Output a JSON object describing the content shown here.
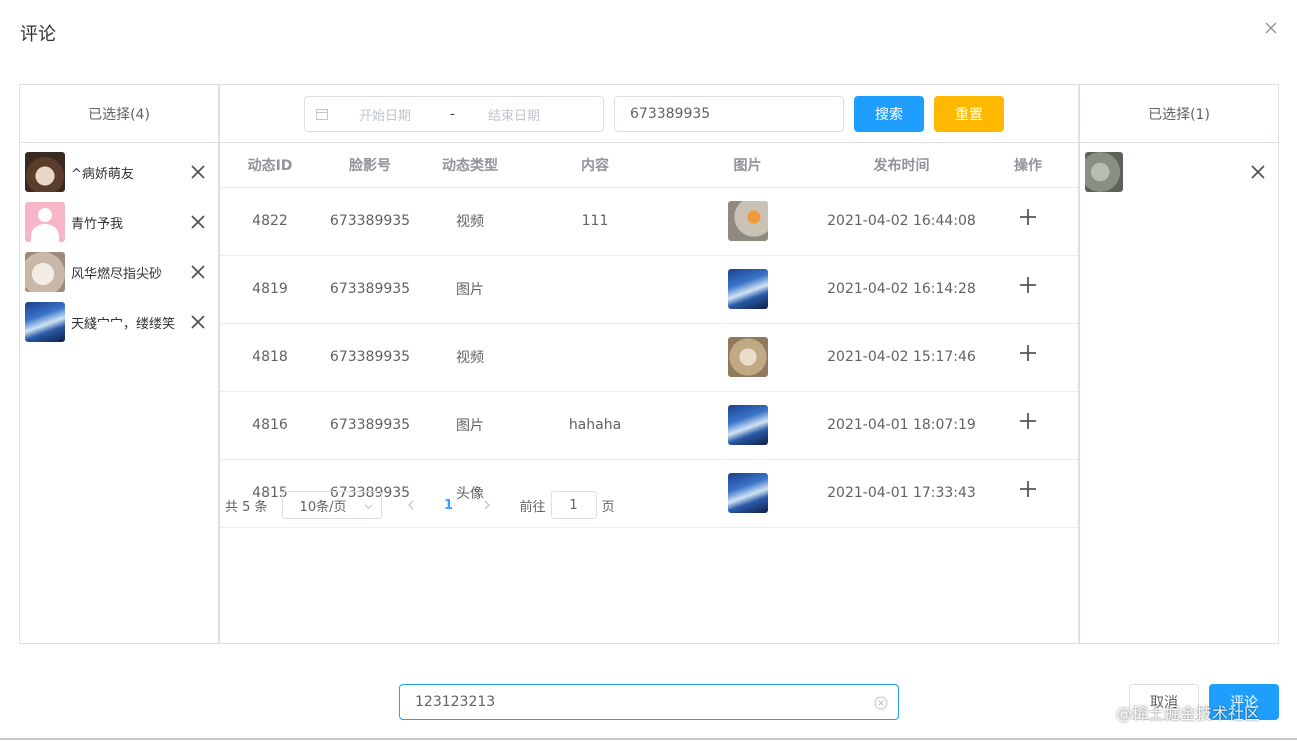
{
  "dialog": {
    "title": "评论"
  },
  "left_panel": {
    "header": "已选择(4)",
    "items": [
      {
        "name": "^病娇萌友",
        "avatar": "cat-avatar"
      },
      {
        "name": "青竹予我",
        "avatar": "pink-silhouette-avatar"
      },
      {
        "name": "风华燃尽指尖砂",
        "avatar": "hamster-avatar"
      },
      {
        "name": "天綫宀宀，缕缕笑",
        "avatar": "sea-avatar"
      }
    ]
  },
  "search": {
    "start_placeholder": "开始日期",
    "separator": "-",
    "end_placeholder": "结束日期",
    "keyword_value": "673389935",
    "search_label": "搜索",
    "reset_label": "重置"
  },
  "table": {
    "columns": [
      "动态ID",
      "脸影号",
      "动态类型",
      "内容",
      "图片",
      "发布时间",
      "操作"
    ],
    "rows": [
      {
        "id": "4822",
        "account": "673389935",
        "type": "视频",
        "content": "111",
        "image": "rock-orange-thumb",
        "time": "2021-04-02 16:44:08"
      },
      {
        "id": "4819",
        "account": "673389935",
        "type": "图片",
        "content": "",
        "image": "sea-thumb",
        "time": "2021-04-02 16:14:28"
      },
      {
        "id": "4818",
        "account": "673389935",
        "type": "视频",
        "content": "",
        "image": "food-thumb",
        "time": "2021-04-02 15:17:46"
      },
      {
        "id": "4816",
        "account": "673389935",
        "type": "图片",
        "content": "hahaha",
        "image": "sea-thumb",
        "time": "2021-04-01 18:07:19"
      },
      {
        "id": "4815",
        "account": "673389935",
        "type": "头像",
        "content": "",
        "image": "sea-thumb",
        "time": "2021-04-01 17:33:43"
      }
    ]
  },
  "pagination": {
    "total": "共 5 条",
    "page_size": "10条/页",
    "current_page": "1",
    "goto_prefix": "前往",
    "goto_value": "1",
    "goto_suffix": "页"
  },
  "right_panel": {
    "header": "已选择(1)",
    "items": [
      {
        "avatar": "rock-avatar"
      }
    ]
  },
  "footer": {
    "comment_value": "123123213",
    "cancel_label": "取消",
    "comment_label": "评论",
    "watermark": "@稀土掘金技术社区"
  },
  "colors": {
    "primary": "#1e9fff",
    "warning": "#ffb800",
    "border": "#dcdfe6"
  }
}
